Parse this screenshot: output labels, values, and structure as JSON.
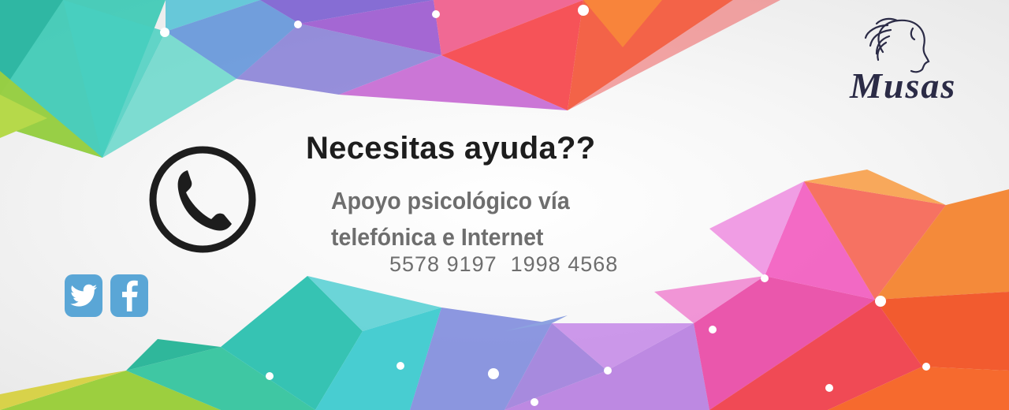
{
  "headline": "Necesitas ayuda??",
  "subtitle": "Apoyo psicológico vía telefónica e Internet",
  "phones": "5578 9197  1998 4568",
  "logo": {
    "text": "Musas"
  },
  "icons": {
    "phone": "phone-icon",
    "twitter": "twitter-icon",
    "facebook": "facebook-icon"
  },
  "colors": {
    "headline": "#1d1d1d",
    "subtitle": "#6e6e6e",
    "social": "#5aa6d6",
    "logo": "#2b2b46"
  }
}
